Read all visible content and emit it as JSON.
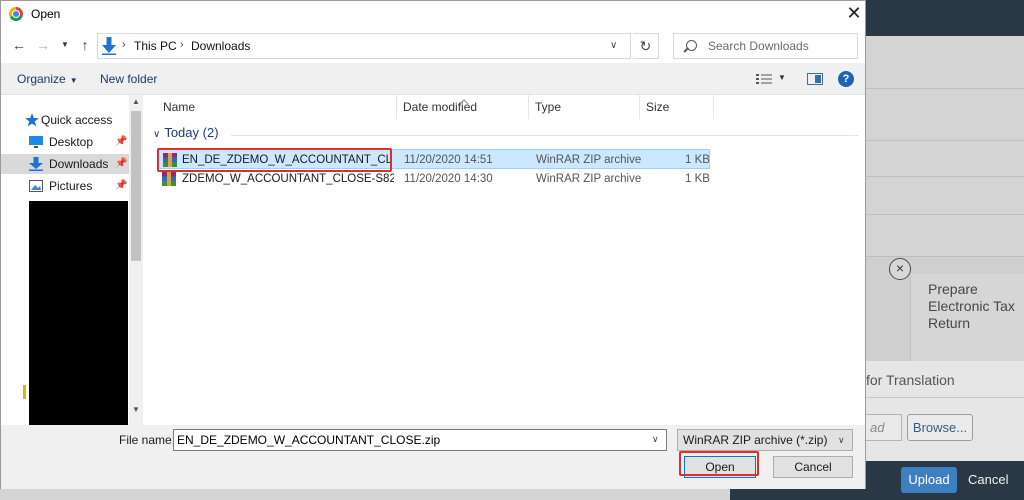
{
  "background_app": {
    "card_title": "Prepare Electronic Tax Return",
    "upload_dialog": {
      "title": "for Translation",
      "input_placeholder": "ad",
      "browse_label": "Browse...",
      "upload_label": "Upload",
      "cancel_label": "Cancel"
    }
  },
  "dialog": {
    "title": "Open",
    "close_icon": "close-icon",
    "nav": {
      "back_icon": "arrow-left-icon",
      "forward_icon": "arrow-right-icon",
      "recent_icon": "chevron-down-icon",
      "up_icon": "arrow-up-icon",
      "breadcrumbs": [
        "This PC",
        "Downloads"
      ],
      "refresh_icon": "refresh-icon",
      "search_placeholder": "Search Downloads"
    },
    "toolbar": {
      "organize_label": "Organize",
      "new_folder_label": "New folder",
      "help_label": "?"
    },
    "navpane": {
      "items": [
        {
          "label": "Quick access",
          "icon": "star-icon"
        },
        {
          "label": "Desktop",
          "icon": "desktop-icon"
        },
        {
          "label": "Downloads",
          "icon": "download-icon"
        },
        {
          "label": "Pictures",
          "icon": "pictures-icon"
        }
      ]
    },
    "filelist": {
      "columns": [
        "Name",
        "Date modified",
        "Type",
        "Size"
      ],
      "group_label": "Today (2)",
      "rows": [
        {
          "name": "EN_DE_ZDEMO_W_ACCOUNTANT_CLOS...",
          "date": "11/20/2020 14:51",
          "type": "WinRAR ZIP archive",
          "size": "1 KB",
          "selected": true
        },
        {
          "name": "ZDEMO_W_ACCOUNTANT_CLOSE-S8210...",
          "date": "11/20/2020 14:30",
          "type": "WinRAR ZIP archive",
          "size": "1 KB",
          "selected": false
        }
      ]
    },
    "bottom": {
      "file_name_label": "File name:",
      "file_name_value": "EN_DE_ZDEMO_W_ACCOUNTANT_CLOSE.zip",
      "filter_value": "WinRAR ZIP archive (*.zip)",
      "open_label": "Open",
      "cancel_label": "Cancel"
    }
  },
  "colors": {
    "selection": "#cce8ff",
    "highlight": "#e02d2d",
    "link": "#1a3a6b",
    "upload_button": "#3e7fc1"
  }
}
